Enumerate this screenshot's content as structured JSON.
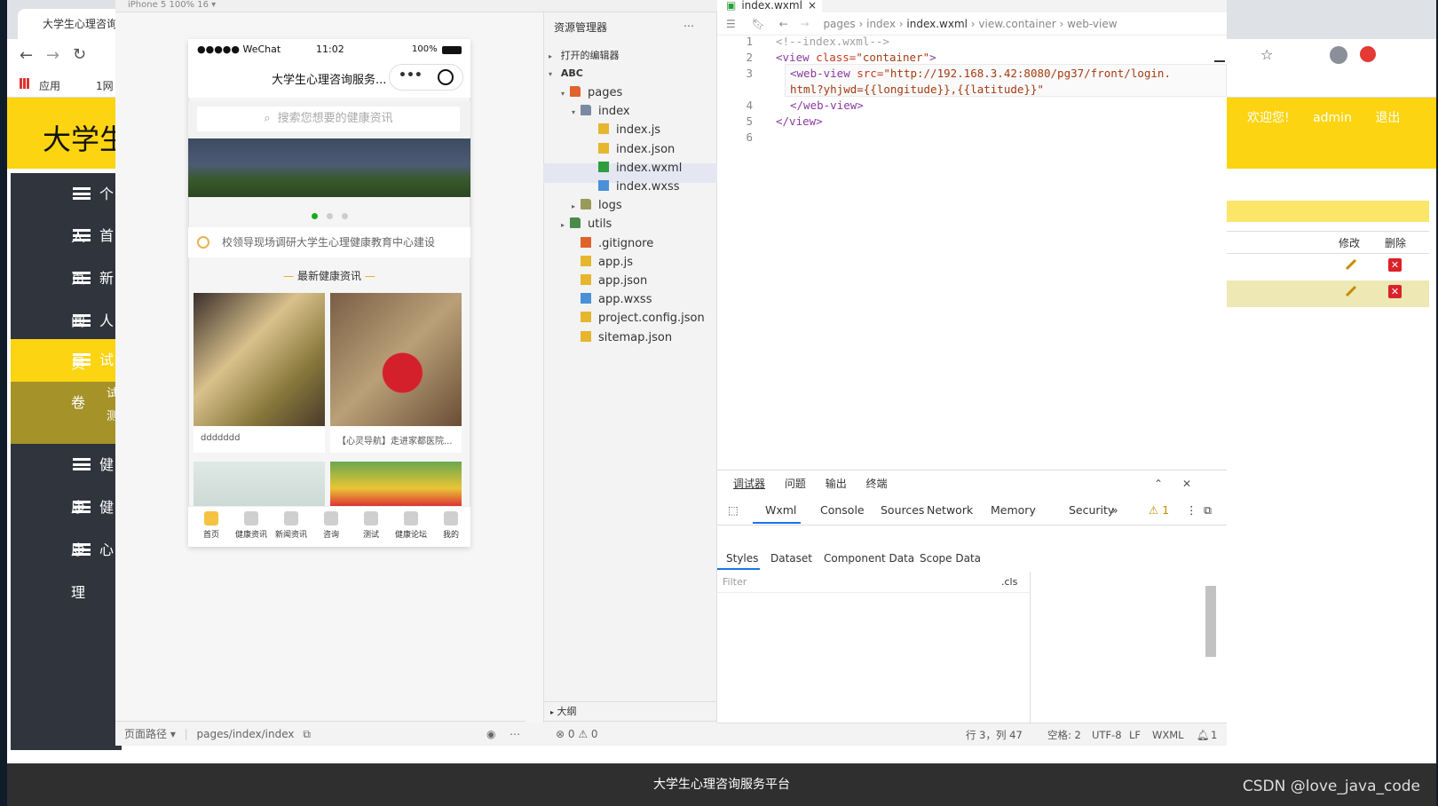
{
  "browser": {
    "tab_title": "大学生心理咨询",
    "bookmarks": {
      "apps": "应用",
      "first": "1网"
    }
  },
  "site": {
    "title": "大学生",
    "welcome": "欢迎您!",
    "user": "admin",
    "logout": "退出",
    "sidebar": [
      "个人",
      "首页",
      "新闻",
      "人员",
      "试卷",
      "健康",
      "健康",
      "心理"
    ],
    "sub_items": [
      "试",
      "测"
    ],
    "table": {
      "edit": "修改",
      "delete": "删除"
    },
    "footer": "大学生心理咨询服务平台"
  },
  "watermark": "CSDN @love_java_code",
  "simulator": {
    "device": "iPhone 5 100% 16 ▾",
    "status_carrier": "●●●●● WeChat",
    "status_time": "11:02",
    "status_battery": "100%",
    "nav_title": "大学生心理咨询服务...",
    "search_placeholder": "搜索您想要的健康资讯",
    "notice": "校领导现场调研大学生心理健康教育中心建设",
    "section_title": "最新健康资讯",
    "cards": [
      {
        "caption": "ddddddd"
      },
      {
        "caption": "【心灵导航】走进家都医院..."
      }
    ],
    "tabs": [
      "首页",
      "健康资讯",
      "新闻资讯",
      "咨询",
      "测试",
      "健康论坛",
      "我的"
    ],
    "path_label": "页面路径 ▾",
    "path_value": "pages/index/index"
  },
  "explorer": {
    "title": "资源管理器",
    "open_editors": "打开的编辑器",
    "project": "ABC",
    "tree": [
      "pages",
      "index",
      "index.js",
      "index.json",
      "index.wxml",
      "index.wxss",
      "logs",
      "utils",
      ".gitignore",
      "app.js",
      "app.json",
      "app.wxss",
      "project.config.json",
      "sitemap.json"
    ],
    "outline": "大纲",
    "problems": "⊗ 0 ⚠ 0"
  },
  "editor": {
    "tab": "index.wxml",
    "breadcrumb": [
      "pages",
      "index",
      "index.wxml",
      "view.container",
      "web-view"
    ],
    "lines": {
      "l1": "<!--index.wxml-->",
      "l2a": "<view",
      "l2b": " class=",
      "l2c": "\"container\"",
      "l2d": ">",
      "l3a": "<web-view",
      "l3b": " src=",
      "l3c": "\"http://192.168.3.42:8080/pg37/front/login.",
      "l3d": "html?yhjwd={{longitude}},{{latitude}}\"",
      "l4": "</web-view>",
      "l5": "</view>"
    }
  },
  "debug": {
    "tabs": [
      "调试器",
      "问题",
      "输出",
      "终端"
    ],
    "devtools": [
      "Wxml",
      "Console",
      "Sources",
      "Network",
      "Memory",
      "Security"
    ],
    "warnings": "⚠ 1",
    "subtabs": [
      "Styles",
      "Dataset",
      "Component Data",
      "Scope Data"
    ],
    "filter_placeholder": "Filter",
    "cls": ".cls"
  },
  "status": {
    "pos": "行 3，列 47",
    "spaces": "空格: 2",
    "enc": "UTF-8",
    "eol": "LF",
    "lang": "WXML",
    "bell": "1"
  }
}
